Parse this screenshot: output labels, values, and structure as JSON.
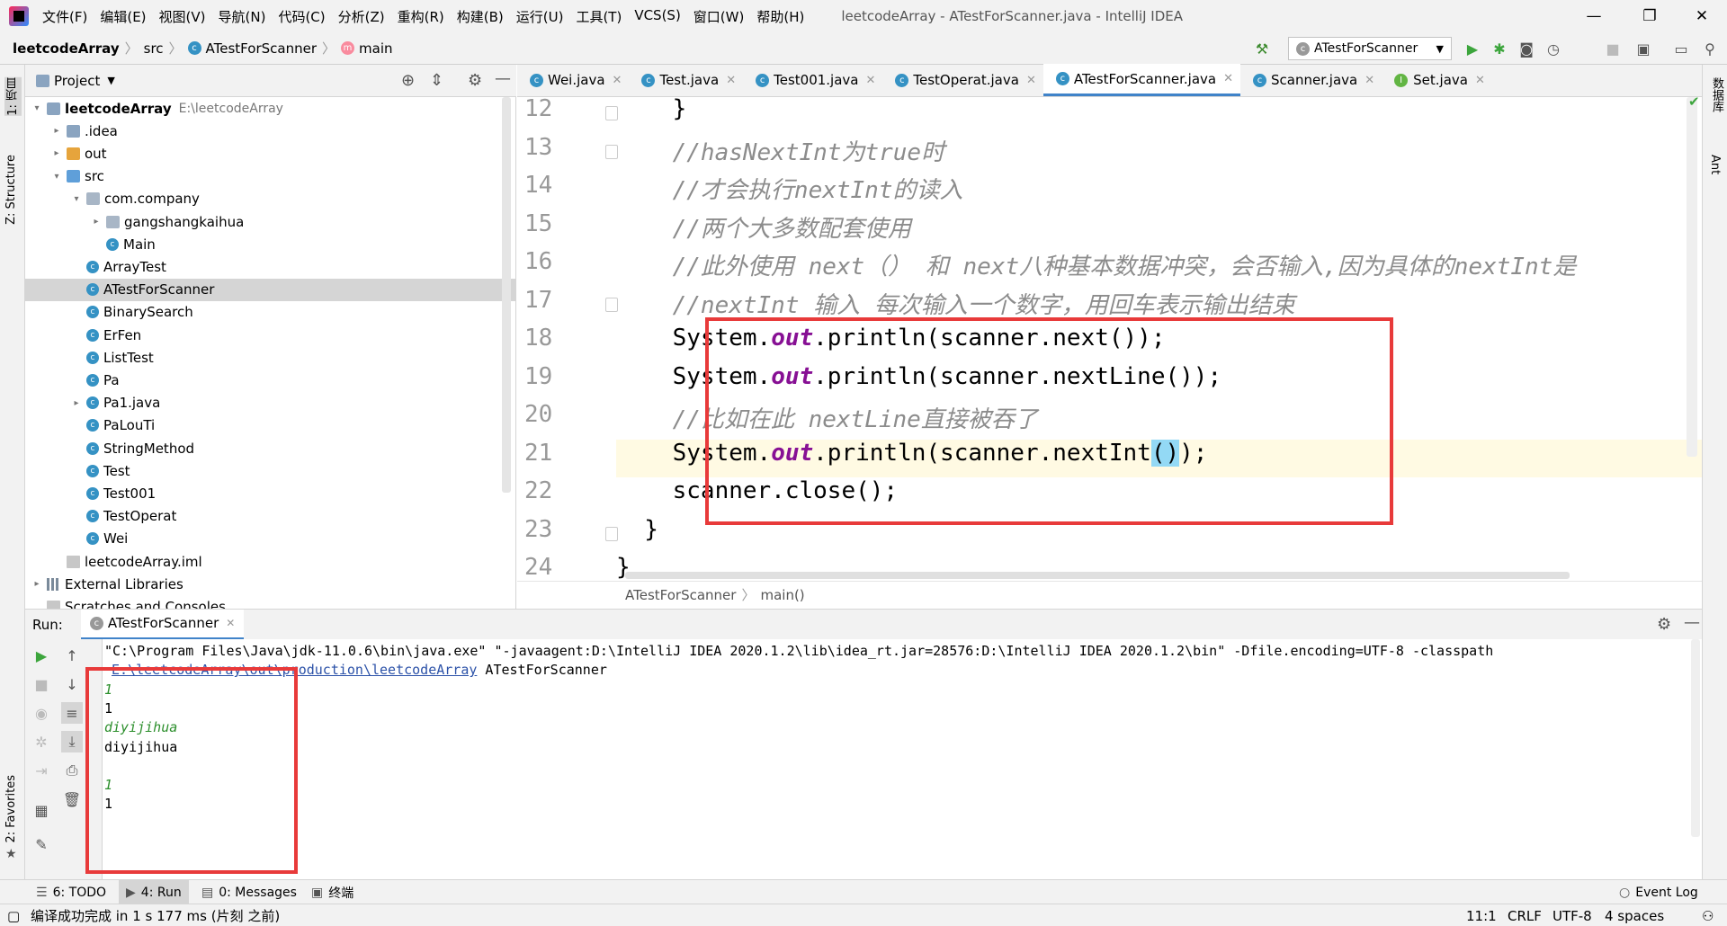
{
  "menu": {
    "items": [
      "文件(F)",
      "编辑(E)",
      "视图(V)",
      "导航(N)",
      "代码(C)",
      "分析(Z)",
      "重构(R)",
      "构建(B)",
      "运行(U)",
      "工具(T)",
      "VCS(S)",
      "窗口(W)",
      "帮助(H)"
    ],
    "window_title": "leetcodeArray - ATestForScanner.java - IntelliJ IDEA"
  },
  "navbar": {
    "project": "leetcodeArray",
    "folder": "src",
    "class": "ATestForScanner",
    "method": "main",
    "run_config": "ATestForScanner"
  },
  "left_stripe": {
    "project": "1: 项目",
    "structure": "Z: Structure",
    "favorites": "2: Favorites"
  },
  "right_stripe": {
    "database": "数据库",
    "ant": "Ant"
  },
  "project_panel": {
    "title": "Project",
    "tree": [
      {
        "label": "leetcodeArray",
        "path": "E:\\leetcodeArray",
        "icon": "folder",
        "level": 0,
        "arrow": "▾",
        "bold": true
      },
      {
        "label": ".idea",
        "icon": "folder",
        "level": 1,
        "arrow": "▸"
      },
      {
        "label": "out",
        "icon": "folder-orange",
        "level": 1,
        "arrow": "▸"
      },
      {
        "label": "src",
        "icon": "folder-blue",
        "level": 1,
        "arrow": "▾"
      },
      {
        "label": "com.company",
        "icon": "package",
        "level": 2,
        "arrow": "▾"
      },
      {
        "label": "gangshangkaihua",
        "icon": "package",
        "level": 3,
        "arrow": "▸"
      },
      {
        "label": "Main",
        "icon": "class",
        "level": 3,
        "arrow": ""
      },
      {
        "label": "ArrayTest",
        "icon": "class",
        "level": 2,
        "arrow": ""
      },
      {
        "label": "ATestForScanner",
        "icon": "class",
        "level": 2,
        "arrow": "",
        "selected": true
      },
      {
        "label": "BinarySearch",
        "icon": "class",
        "level": 2,
        "arrow": ""
      },
      {
        "label": "ErFen",
        "icon": "class",
        "level": 2,
        "arrow": ""
      },
      {
        "label": "ListTest",
        "icon": "class",
        "level": 2,
        "arrow": ""
      },
      {
        "label": "Pa",
        "icon": "class",
        "level": 2,
        "arrow": ""
      },
      {
        "label": "Pa1.java",
        "icon": "class",
        "level": 2,
        "arrow": "▸"
      },
      {
        "label": "PaLouTi",
        "icon": "class",
        "level": 2,
        "arrow": ""
      },
      {
        "label": "StringMethod",
        "icon": "class",
        "level": 2,
        "arrow": ""
      },
      {
        "label": "Test",
        "icon": "class",
        "level": 2,
        "arrow": ""
      },
      {
        "label": "Test001",
        "icon": "class",
        "level": 2,
        "arrow": ""
      },
      {
        "label": "TestOperat",
        "icon": "class",
        "level": 2,
        "arrow": ""
      },
      {
        "label": "Wei",
        "icon": "class",
        "level": 2,
        "arrow": ""
      },
      {
        "label": "leetcodeArray.iml",
        "icon": "file",
        "level": 1,
        "arrow": ""
      },
      {
        "label": "External Libraries",
        "icon": "library",
        "level": 0,
        "arrow": "▸"
      },
      {
        "label": "Scratches and Consoles",
        "icon": "scratch",
        "level": 0,
        "arrow": ""
      }
    ]
  },
  "tabs": [
    {
      "label": "Wei.java",
      "icon": "class"
    },
    {
      "label": "Test.java",
      "icon": "class"
    },
    {
      "label": "Test001.java",
      "icon": "class"
    },
    {
      "label": "TestOperat.java",
      "icon": "class"
    },
    {
      "label": "ATestForScanner.java",
      "icon": "class",
      "active": true
    },
    {
      "label": "Scanner.java",
      "icon": "class"
    },
    {
      "label": "Set.java",
      "icon": "interface"
    }
  ],
  "editor": {
    "lines": [
      {
        "n": "12",
        "parts": [
          {
            "t": "    }",
            "c": ""
          }
        ]
      },
      {
        "n": "13",
        "parts": [
          {
            "t": "    //hasNextInt为true时",
            "c": "cmt"
          }
        ]
      },
      {
        "n": "14",
        "parts": [
          {
            "t": "    //才会执行nextInt的读入",
            "c": "cmt"
          }
        ]
      },
      {
        "n": "15",
        "parts": [
          {
            "t": "    //两个大多数配套使用",
            "c": "cmt"
          }
        ]
      },
      {
        "n": "16",
        "parts": [
          {
            "t": "    //此外使用 next（） 和 next八种基本数据冲突，会否输入,因为具体的nextInt是",
            "c": "cmt"
          }
        ]
      },
      {
        "n": "17",
        "parts": [
          {
            "t": "    //nextInt 输入 每次输入一个数字，用回车表示输出结束",
            "c": "cmt"
          }
        ]
      },
      {
        "n": "18",
        "parts": [
          {
            "t": "    System.",
            "c": ""
          },
          {
            "t": "out",
            "c": "fld"
          },
          {
            "t": ".println(scanner.next());",
            "c": ""
          }
        ]
      },
      {
        "n": "19",
        "parts": [
          {
            "t": "    System.",
            "c": ""
          },
          {
            "t": "out",
            "c": "fld"
          },
          {
            "t": ".println(scanner.nextLine());",
            "c": ""
          }
        ]
      },
      {
        "n": "20",
        "parts": [
          {
            "t": "    //比如在此 nextLine直接被吞了",
            "c": "cmt"
          }
        ]
      },
      {
        "n": "21",
        "parts": [
          {
            "t": "    System.",
            "c": ""
          },
          {
            "t": "out",
            "c": "fld"
          },
          {
            "t": ".println(scanner.nextInt",
            "c": ""
          },
          {
            "t": "()",
            "c": "brace-hl"
          },
          {
            "t": ");",
            "c": ""
          }
        ]
      },
      {
        "n": "22",
        "parts": [
          {
            "t": "    scanner.close();",
            "c": ""
          }
        ]
      },
      {
        "n": "23",
        "parts": [
          {
            "t": "  }",
            "c": ""
          }
        ]
      },
      {
        "n": "24",
        "parts": [
          {
            "t": "}",
            "c": ""
          }
        ]
      }
    ],
    "breadcrumb_class": "ATestForScanner",
    "breadcrumb_method": "main()"
  },
  "run": {
    "label": "Run:",
    "tab": "ATestForScanner",
    "console": [
      {
        "text": "\"C:\\Program Files\\Java\\jdk-11.0.6\\bin\\java.exe\" \"-javaagent:D:\\IntelliJ IDEA 2020.1.2\\lib\\idea_rt.jar=28576:D:\\IntelliJ IDEA 2020.1.2\\bin\" -Dfile.encoding=UTF-8 -classpath",
        "c": ""
      },
      {
        "text": "E:\\leetcodeArray\\out\\production\\leetcodeArray",
        "c": "clink",
        "suffix": " ATestForScanner"
      },
      {
        "text": "1",
        "c": "cin"
      },
      {
        "text": "1",
        "c": ""
      },
      {
        "text": "diyijihua",
        "c": "cin"
      },
      {
        "text": "diyijihua",
        "c": ""
      },
      {
        "text": "",
        "c": ""
      },
      {
        "text": "1",
        "c": "cin"
      },
      {
        "text": "1",
        "c": ""
      }
    ]
  },
  "bottom_tools": {
    "todo": "6: TODO",
    "run": "4: Run",
    "messages": "0: Messages",
    "terminal": "终端",
    "event_log": "Event Log"
  },
  "status": {
    "message": "编译成功完成 in 1 s 177 ms (片刻 之前)",
    "position": "11:1",
    "line_sep": "CRLF",
    "encoding": "UTF-8",
    "indent": "4 spaces"
  },
  "colors": {
    "accent": "#4083c9",
    "highlight_box": "#e83a3a",
    "user_input": "#2c8f2c",
    "field": "#871094"
  }
}
